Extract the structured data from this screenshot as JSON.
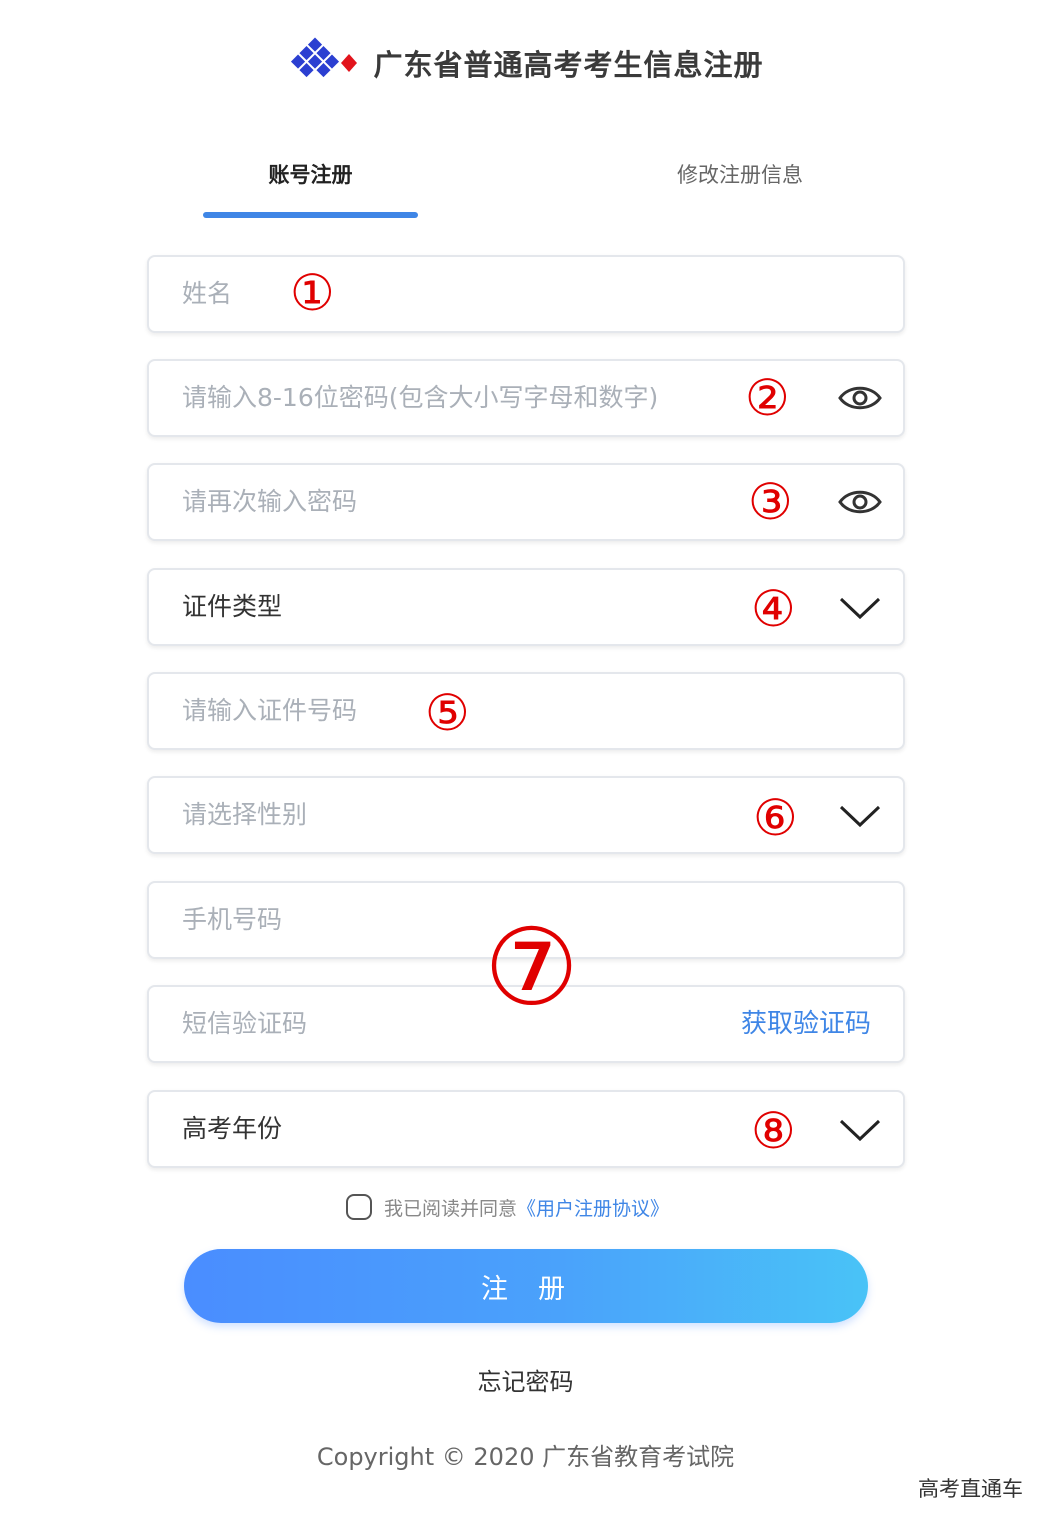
{
  "header": {
    "title": "广东省普通高考考生信息注册"
  },
  "tabs": [
    {
      "label": "账号注册",
      "active": true
    },
    {
      "label": "修改注册信息",
      "active": false
    }
  ],
  "form": {
    "name_placeholder": "姓名",
    "password_placeholder": "请输入8-16位密码(包含大小写字母和数字)",
    "confirm_password_placeholder": "请再次输入密码",
    "id_type_value": "证件类型",
    "id_number_placeholder": "请输入证件号码",
    "gender_placeholder": "请选择性别",
    "phone_placeholder": "手机号码",
    "sms_code_placeholder": "短信验证码",
    "get_code_label": "获取验证码",
    "exam_year_value": "高考年份"
  },
  "annotations": {
    "a1": "①",
    "a2": "②",
    "a3": "③",
    "a4": "④",
    "a5": "⑤",
    "a6": "⑥",
    "a7": "⑦",
    "a8": "⑧"
  },
  "agreement": {
    "text": "我已阅读并同意",
    "link": "《用户注册协议》",
    "checked": false
  },
  "submit_label": "注册",
  "forgot_label": "忘记密码",
  "copyright": "Copyright © 2020 广东省教育考试院",
  "watermark": "高考直通车",
  "colors": {
    "accent": "#3f86e6",
    "annotation": "#e00000",
    "placeholder": "#aab0b8",
    "button_gradient_start": "#4a8dff",
    "button_gradient_end": "#49c3f7"
  },
  "icons": {
    "logo": "diamond-grid-logo",
    "visibility": "eye-icon",
    "dropdown": "chevron-down-icon"
  }
}
